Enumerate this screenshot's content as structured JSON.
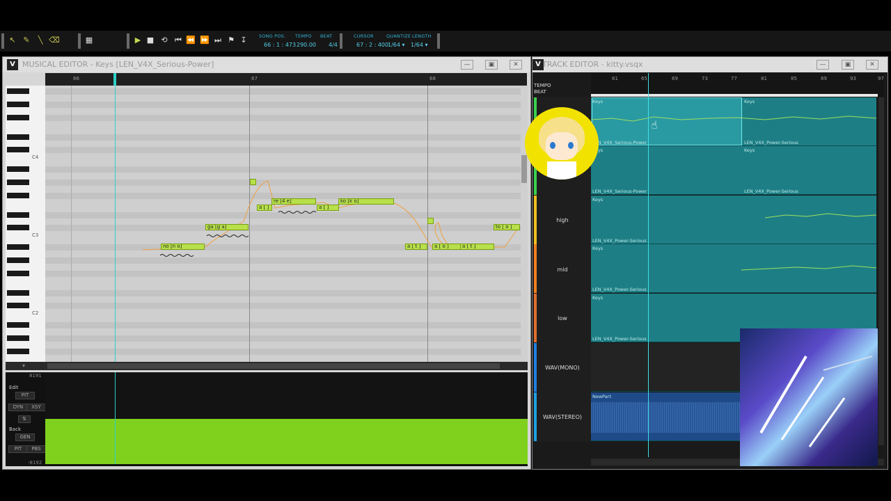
{
  "toolbar": {
    "labels": {
      "song_pos": "SONG POS.",
      "tempo": "TEMPO",
      "beat": "BEAT",
      "cursor": "CURSOR",
      "quantize": "QUANTIZE",
      "length": "LENGTH"
    },
    "values": {
      "song_pos": "66 : 1 : 473",
      "tempo": "290.00",
      "beat": "4/4",
      "cursor": "67 : 2 : 400",
      "quantize": "1/64 ▾",
      "length": "1/64 ▾"
    }
  },
  "musical_editor": {
    "logo": "V",
    "title": "MUSICAL EDITOR - Keys [LEN_V4X_Serious-Power]",
    "ruler": [
      "66",
      "67",
      "68"
    ],
    "octave_labels": [
      "C4",
      "C3",
      "C2"
    ],
    "notes": [
      {
        "lyric": "no [n o]"
      },
      {
        "lyric": "ga [g a]"
      },
      {
        "lyric": "a [ ]"
      },
      {
        "lyric": "re [4 e]"
      },
      {
        "lyric": "a [ ]"
      },
      {
        "lyric": "ko [k o]"
      },
      {
        "lyric": "a [ t ]"
      },
      {
        "lyric": "a [ o ]"
      },
      {
        "lyric": "a [ t ]"
      },
      {
        "lyric": "to [ o ]"
      }
    ],
    "control": {
      "max": "8191",
      "min": "-8192",
      "edit_label": "Edit",
      "edit_value": "PIT",
      "dyn": "DYN",
      "xsy": "XSY",
      "back_label": "Back",
      "back_value": "GEN",
      "pit": "PIT",
      "pbs": "PBS"
    }
  },
  "track_editor": {
    "logo": "V",
    "title": "TRACK EDITOR - kitty.vsqx",
    "rows": [
      "TEMPO",
      "BEAT"
    ],
    "ruler": [
      "61",
      "65",
      "69",
      "73",
      "77",
      "81",
      "85",
      "89",
      "93",
      "97"
    ],
    "tracks": [
      {
        "name": "",
        "part": "Keys",
        "part2": "Keys",
        "singer": "LEN_V4X_Serious-Power",
        "singer2": "LEN_V4X_Power-Serious"
      },
      {
        "name": "",
        "part": "Keys",
        "part2": "Keys",
        "singer": "LEN_V4X_Serious-Power",
        "singer2": "LEN_V4X_Power-Serious"
      },
      {
        "name": "high",
        "part": "Keys",
        "singer": "LEN_V4X_Power-Serious"
      },
      {
        "name": "mid",
        "part": "Keys",
        "singer": "LEN_V4X_Power-Serious"
      },
      {
        "name": "low",
        "part": "Keys",
        "singer": "LEN_V4X_Power-Serious"
      }
    ],
    "wav_tracks": [
      {
        "name": "WAV(MONO)"
      },
      {
        "name": "WAV(STEREO)",
        "part": "NewPart"
      }
    ]
  },
  "colors": {
    "note": "#b7e04a",
    "track": "#1d7f85",
    "accent": "#2fb5d8",
    "pitch_area": "#7fd11e"
  }
}
